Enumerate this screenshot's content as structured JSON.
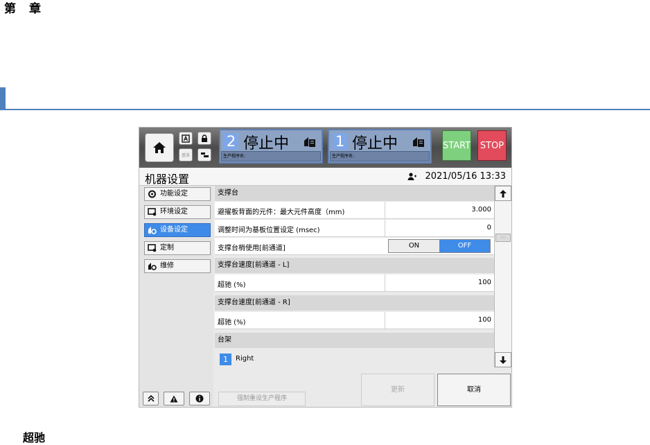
{
  "page": {
    "chapter_heading": "第　章",
    "bottom_heading": "超驰"
  },
  "screen": {
    "topbar": {
      "small_btn_label": "基准",
      "lanes": [
        {
          "number": "2",
          "status": "停止中",
          "program_label": "生产程序名:"
        },
        {
          "number": "1",
          "status": "停止中",
          "program_label": "生产程序名:"
        }
      ],
      "start_label": "START",
      "stop_label": "STOP"
    },
    "title": "机器设置",
    "datetime": "2021/05/16 13:33",
    "sidebar": {
      "items": [
        {
          "label": "功能设定",
          "icon": "gear-icon",
          "active": false
        },
        {
          "label": "环境设定",
          "icon": "monitor-icon",
          "active": false
        },
        {
          "label": "设备设定",
          "icon": "device-icon",
          "active": true
        },
        {
          "label": "定制",
          "icon": "custom-icon",
          "active": false
        },
        {
          "label": "维修",
          "icon": "repair-icon",
          "active": false
        }
      ]
    },
    "content": {
      "section1": "支撑台",
      "row1_label": "避擢板背面的元件：最大元件高度（mm)",
      "row1_value": "3.000",
      "row2_label": "调整时间为基板位置设定 (msec)",
      "row2_value": "0",
      "row3_label": "支撑台梢使用[前通道]",
      "toggle_on": "ON",
      "toggle_off": "OFF",
      "section2": "支撑台速度[前通道 - L]",
      "row4_label": "超驰 (%)",
      "row4_value": "100",
      "section3": "支撑台速度[前通道 - R]",
      "row5_label": "超驰 (%)",
      "row5_value": "100",
      "section4": "台架",
      "lane_number": "1",
      "lane_side": "Right"
    },
    "buttons": {
      "reset": "强制重设生产程序",
      "update": "更新",
      "cancel": "取消"
    }
  }
}
